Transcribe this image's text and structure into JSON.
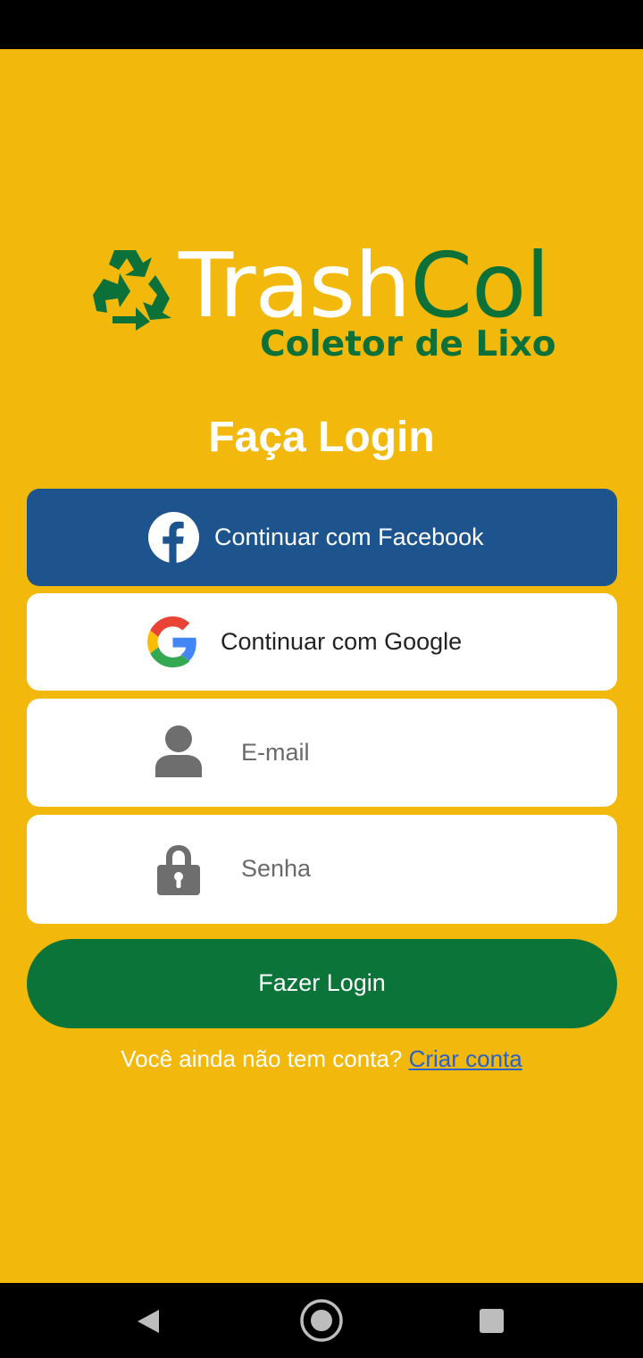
{
  "app": {
    "logo_text_white": "Trash",
    "logo_text_green": "Col",
    "logo_subtitle": "Coletor de Lixo"
  },
  "colors": {
    "background": "#F2B90C",
    "facebook": "#1D548D",
    "primary_green": "#0B7539",
    "link": "#2A62C9"
  },
  "login": {
    "title": "Faça Login",
    "facebook_label": "Continuar com Facebook",
    "google_label": "Continuar com Google",
    "email_placeholder": "E-mail",
    "email_value": "",
    "password_placeholder": "Senha",
    "password_value": "",
    "submit_label": "Fazer Login",
    "no_account_text": "Você ainda não tem conta?",
    "create_account_link": "Criar conta"
  },
  "icons": {
    "logo": "recycle-icon",
    "facebook": "facebook-icon",
    "google": "google-icon",
    "email": "user-icon",
    "password": "lock-icon",
    "nav_back": "back-triangle-icon",
    "nav_home": "home-circle-icon",
    "nav_recent": "recents-square-icon"
  }
}
